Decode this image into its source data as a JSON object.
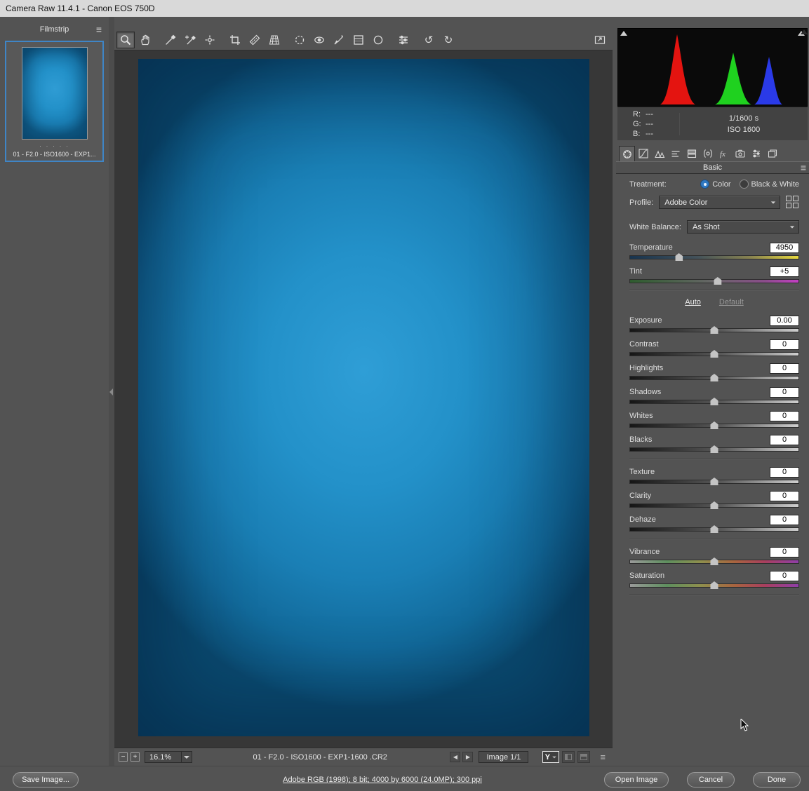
{
  "window": {
    "title": "Camera Raw 11.4.1  -  Canon EOS 750D"
  },
  "filmstrip": {
    "header": "Filmstrip",
    "items": [
      {
        "label": "01 - F2.0 - ISO1600 - EXP1...",
        "selected": true,
        "rating_dots": "· · · · ·"
      }
    ]
  },
  "toolbar": {
    "tools": [
      "zoom-tool",
      "hand-tool",
      "white-balance-tool",
      "color-sampler-tool",
      "targeted-adjustment-tool",
      "crop-tool",
      "straighten-tool",
      "transform-tool",
      "spot-removal-tool",
      "red-eye-tool",
      "adjustment-brush-tool",
      "graduated-filter-tool",
      "radial-filter-tool",
      "preferences-tool",
      "rotate-left-tool",
      "rotate-right-tool",
      "toggle-fullscreen-button"
    ],
    "selected_tool": "zoom-tool",
    "rotate_left_glyph": "↺",
    "rotate_right_glyph": "↻"
  },
  "histogram": {
    "r_label": "R:",
    "g_label": "G:",
    "b_label": "B:",
    "r_value": "---",
    "g_value": "---",
    "b_value": "---",
    "shutter": "1/1600 s",
    "iso": "ISO 1600",
    "peaks": [
      {
        "channel": "red",
        "center_pct": 32,
        "height_pct": 93
      },
      {
        "channel": "green",
        "center_pct": 61,
        "height_pct": 68
      },
      {
        "channel": "blue",
        "center_pct": 79,
        "height_pct": 63
      }
    ]
  },
  "panel_tabs": [
    "basic",
    "tone-curve",
    "detail",
    "hsl-adjustments",
    "split-toning",
    "lens-corrections",
    "effects",
    "camera-calibration",
    "presets",
    "snapshots"
  ],
  "basic": {
    "title": "Basic",
    "treatment_label": "Treatment:",
    "treatment_options": [
      {
        "label": "Color",
        "selected": true
      },
      {
        "label": "Black & White",
        "selected": false
      }
    ],
    "profile_label": "Profile:",
    "profile_value": "Adobe Color",
    "white_balance_label": "White Balance:",
    "white_balance_value": "As Shot",
    "auto_label": "Auto",
    "default_label": "Default",
    "sliders": [
      {
        "label": "Temperature",
        "value": "4950",
        "pos": 29
      },
      {
        "label": "Tint",
        "value": "+5",
        "pos": 52
      },
      {
        "label": "Exposure",
        "value": "0.00",
        "pos": 50
      },
      {
        "label": "Contrast",
        "value": "0",
        "pos": 50
      },
      {
        "label": "Highlights",
        "value": "0",
        "pos": 50
      },
      {
        "label": "Shadows",
        "value": "0",
        "pos": 50
      },
      {
        "label": "Whites",
        "value": "0",
        "pos": 50
      },
      {
        "label": "Blacks",
        "value": "0",
        "pos": 50
      },
      {
        "label": "Texture",
        "value": "0",
        "pos": 50
      },
      {
        "label": "Clarity",
        "value": "0",
        "pos": 50
      },
      {
        "label": "Dehaze",
        "value": "0",
        "pos": 50
      },
      {
        "label": "Vibrance",
        "value": "0",
        "pos": 50
      },
      {
        "label": "Saturation",
        "value": "0",
        "pos": 50
      }
    ]
  },
  "canvas_bar": {
    "zoom_out": "−",
    "zoom_in": "+",
    "zoom_level": "16.1%",
    "filename": "01 - F2.0 - ISO1600 - EXP1-1600 .CR2",
    "prev_glyph": "◀",
    "next_glyph": "▶",
    "image_counter": "Image 1/1",
    "preview_toggle": "Y"
  },
  "footer": {
    "save_button": "Save Image...",
    "workflow_link": "Adobe RGB (1998); 8 bit; 4000 by 6000 (24.0MP); 300 ppi",
    "open_button": "Open Image",
    "cancel_button": "Cancel",
    "done_button": "Done"
  },
  "colors": {
    "panel_bg": "#535353",
    "canvas_bg": "#373737",
    "selection_blue": "#3f85c6",
    "histogram_red": "#e41410",
    "histogram_green": "#1fd11f",
    "histogram_blue": "#2a3ae8"
  }
}
